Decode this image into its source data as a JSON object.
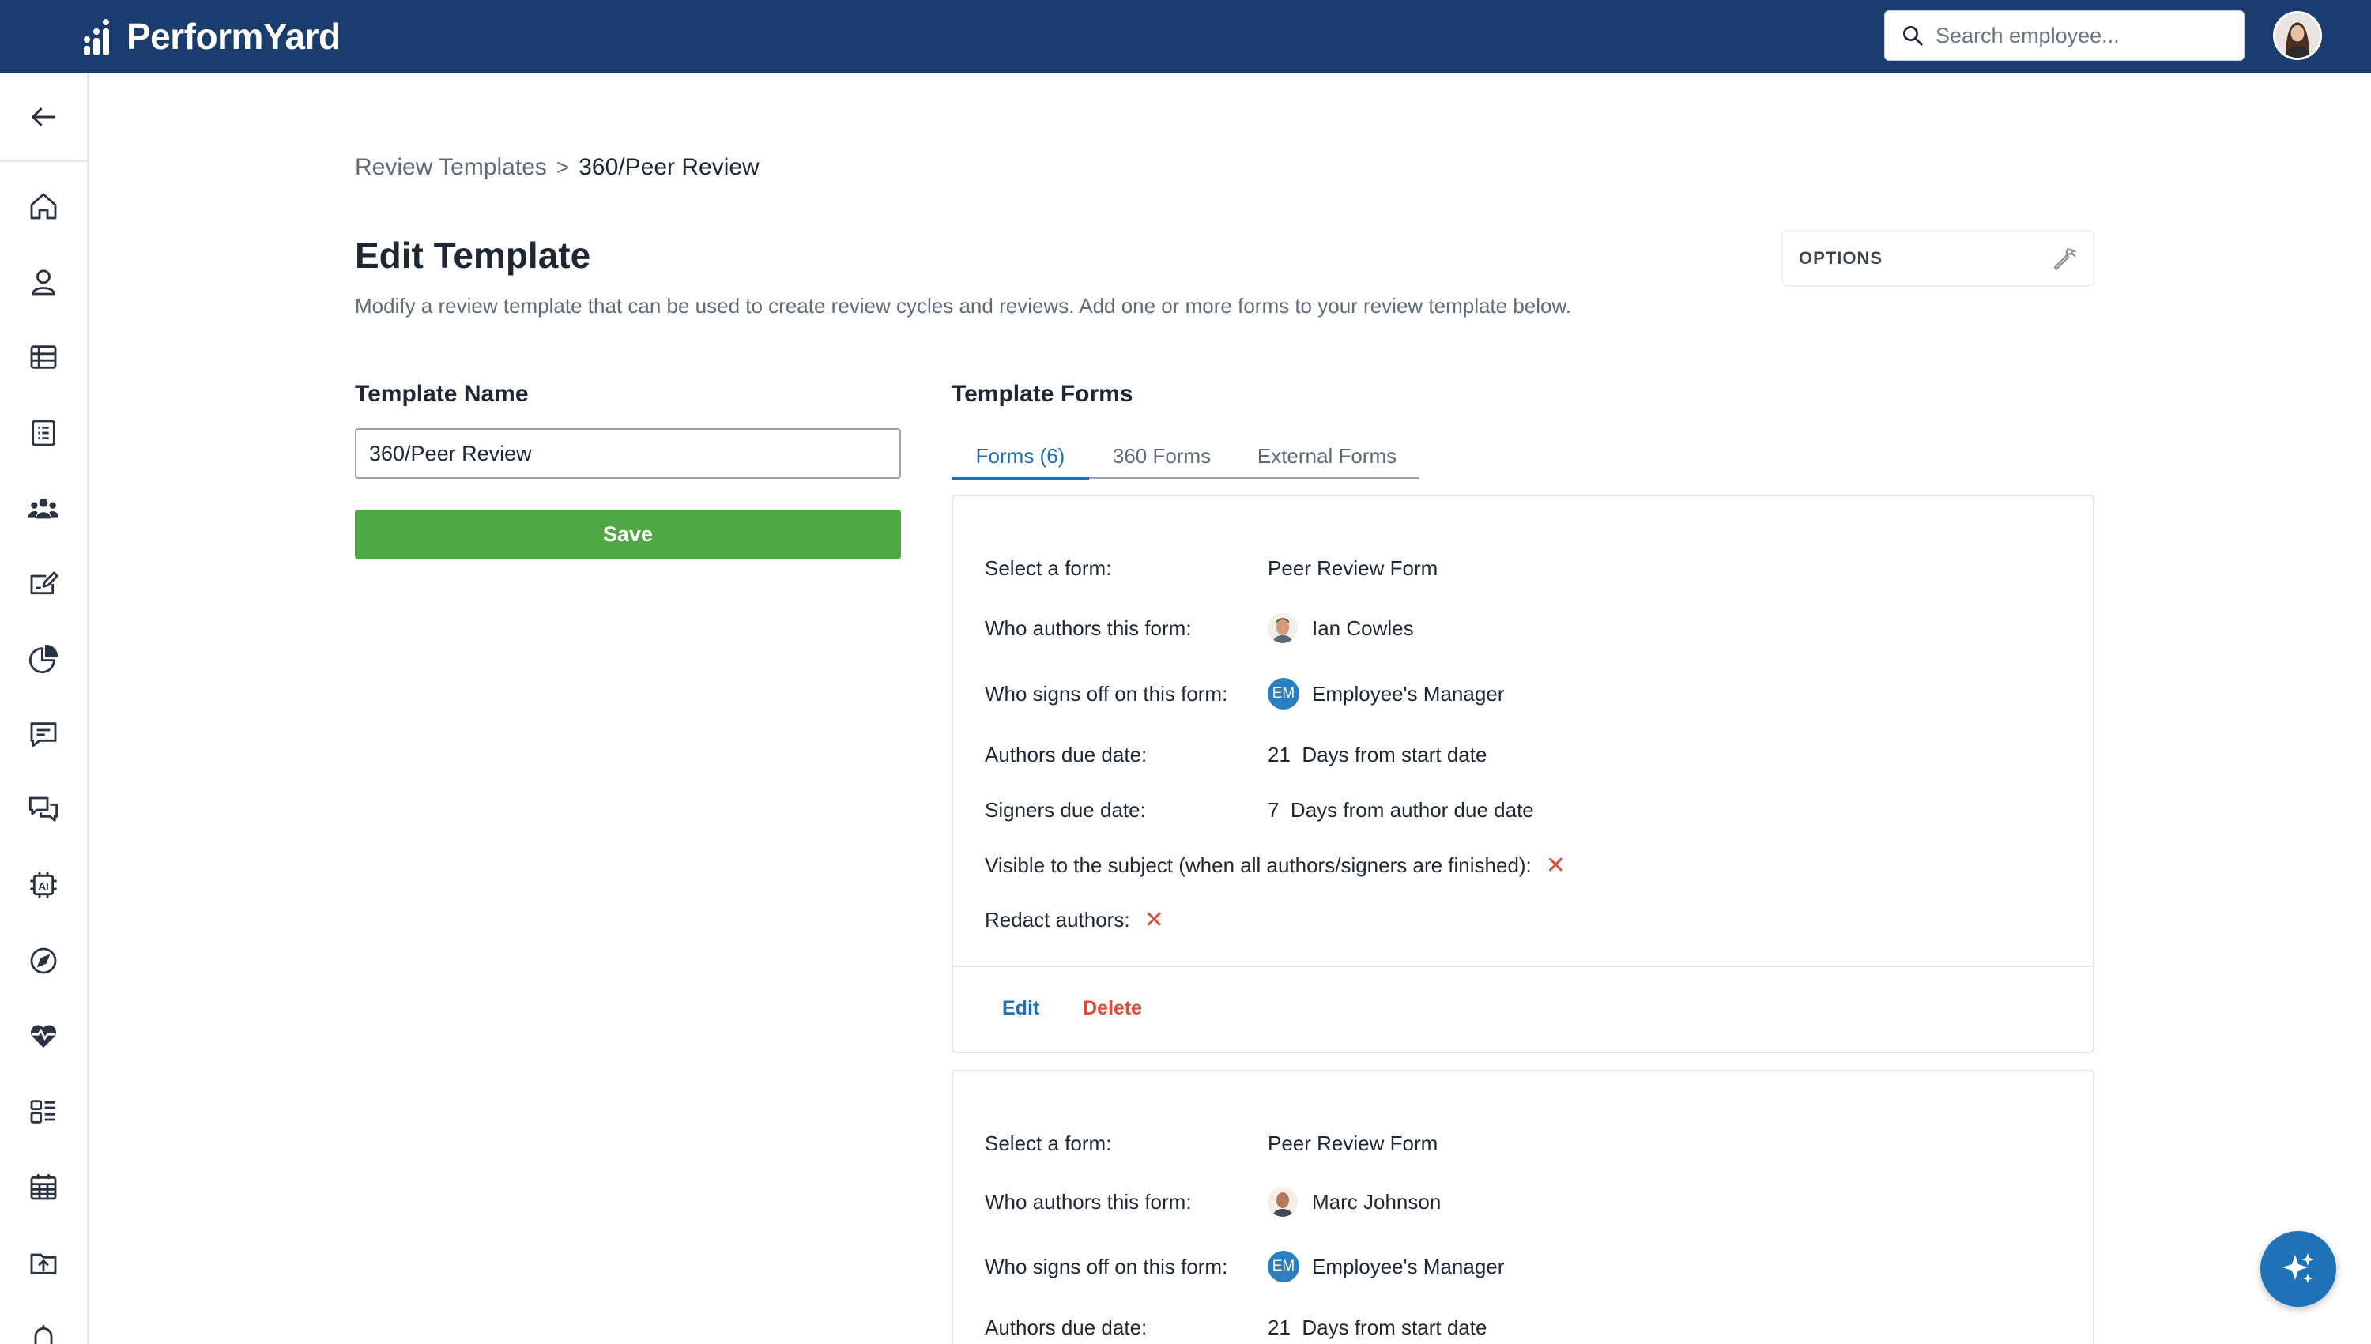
{
  "brand": {
    "name": "PerformYard"
  },
  "search": {
    "placeholder": "Search employee..."
  },
  "breadcrumb": {
    "parent": "Review Templates",
    "separator": ">",
    "current": "360/Peer Review"
  },
  "header": {
    "title": "Edit Template",
    "subtitle": "Modify a review template that can be used to create review cycles and reviews. Add one or more forms to your review template below.",
    "options_label": "OPTIONS"
  },
  "template_name": {
    "label": "Template Name",
    "value": "360/Peer Review",
    "save_label": "Save"
  },
  "template_forms": {
    "label": "Template Forms",
    "tabs": [
      {
        "label": "Forms (6)",
        "active": true
      },
      {
        "label": "360 Forms",
        "active": false
      },
      {
        "label": "External Forms",
        "active": false
      }
    ]
  },
  "form_labels": {
    "select_form": "Select a form:",
    "authors": "Who authors this form:",
    "signers": "Who signs off on this form:",
    "authors_due": "Authors due date:",
    "signers_due": "Signers due date:",
    "visible": "Visible to the subject (when all authors/signers are finished):",
    "redact": "Redact authors:"
  },
  "forms": [
    {
      "form_name": "Peer Review Form",
      "author": "Ian Cowles",
      "signer_initials": "EM",
      "signer": "Employee's Manager",
      "authors_due_days": "21",
      "authors_due_text": "Days from start date",
      "signers_due_days": "7",
      "signers_due_text": "Days from author due date",
      "visible_mark": "✕",
      "redact_mark": "✕",
      "edit_label": "Edit",
      "delete_label": "Delete"
    },
    {
      "form_name": "Peer Review Form",
      "author": "Marc Johnson",
      "signer_initials": "EM",
      "signer": "Employee's Manager",
      "authors_due_days": "21",
      "authors_due_text": "Days from start date"
    }
  ],
  "colors": {
    "topbar": "#1b3c6e",
    "accent": "#1a6fb5",
    "save": "#4fa844",
    "danger": "#e34a3b"
  },
  "icons": {
    "sidebar": [
      "back-arrow-icon",
      "home-icon",
      "person-icon",
      "table-icon",
      "list-icon",
      "team-icon",
      "review-edit-icon",
      "pie-chart-icon",
      "message-icon",
      "chat-icon",
      "ai-chip-icon",
      "compass-icon",
      "heart-pulse-icon",
      "dashboard-icon",
      "calendar-icon",
      "upload-icon",
      "bell-icon"
    ]
  }
}
